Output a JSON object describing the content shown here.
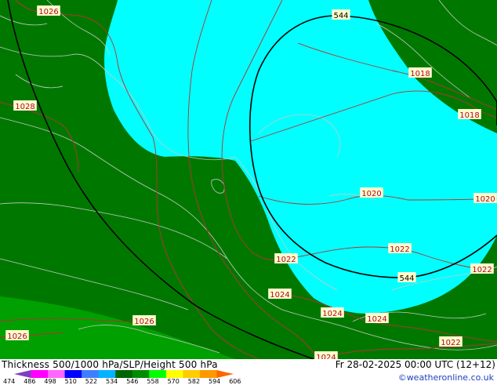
{
  "map": {
    "isobar_labels": [
      "1026",
      "1028",
      "1018",
      "1018",
      "1020",
      "1020",
      "1022",
      "1022",
      "1022",
      "1024",
      "1024",
      "1024",
      "1026",
      "1026",
      "1022",
      "1024"
    ],
    "height_labels": [
      "544",
      "544"
    ],
    "colors": {
      "band_534": "#007800",
      "band_540": "#00a000",
      "band_546": "#00ffff",
      "isobar": "#b33333",
      "height_contour": "#000000",
      "coastline": "#c8c8c8"
    }
  },
  "footer": {
    "title": "Thickness 500/1000 hPa/SLP/Height 500 hPa",
    "valid_time": "Fr 28-02-2025 00:00 UTC (12+12)",
    "credit": "©weatheronline.co.uk",
    "scale_values": [
      "474",
      "486",
      "498",
      "510",
      "522",
      "534",
      "546",
      "558",
      "570",
      "582",
      "594",
      "606"
    ],
    "scale_colors": [
      "#7f3fbf",
      "#ff00ff",
      "#ff66ff",
      "#0000ff",
      "#3f7fff",
      "#00b3ff",
      "#006400",
      "#008c00",
      "#00ff00",
      "#ffff00",
      "#ffcc00",
      "#ff9900",
      "#ff6600"
    ]
  }
}
